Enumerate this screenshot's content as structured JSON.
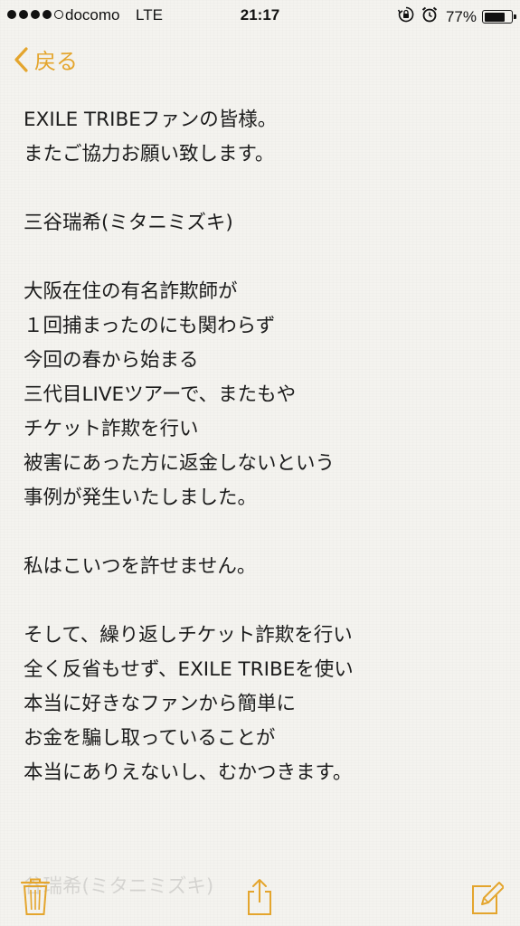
{
  "status_bar": {
    "carrier": "docomo",
    "network": "LTE",
    "time": "21:17",
    "battery_percent": "77%",
    "battery_level": 0.77,
    "signal_bars": 4,
    "signal_total": 5
  },
  "nav": {
    "back_label": "戻る"
  },
  "note": {
    "paragraphs": [
      [
        "EXILE TRIBEファンの皆様。",
        "またご協力お願い致します。"
      ],
      [
        "三谷瑞希(ミタニミズキ)"
      ],
      [
        "大阪在住の有名詐欺師が",
        "１回捕まったのにも関わらず",
        "今回の春から始まる",
        "三代目LIVEツアーで、またもや",
        "チケット詐欺を行い",
        "被害にあった方に返金しないという",
        "事例が発生いたしました。"
      ],
      [
        "私はこいつを許せません。"
      ],
      [
        "そして、繰り返しチケット詐欺を行い",
        "全く反省もせず、EXILE TRIBEを使い",
        "本当に好きなファンから簡単に",
        "お金を騙し取っていることが",
        "本当にありえないし、むかつきます。"
      ]
    ]
  },
  "toolbar": {
    "faded_text": "谷瑞希(ミタニミズキ)"
  },
  "colors": {
    "accent": "#e4a52d",
    "background": "#f4f3ef"
  },
  "icons": {
    "back": "chevron-left-icon",
    "trash": "trash-icon",
    "share": "share-icon",
    "compose": "compose-icon"
  }
}
